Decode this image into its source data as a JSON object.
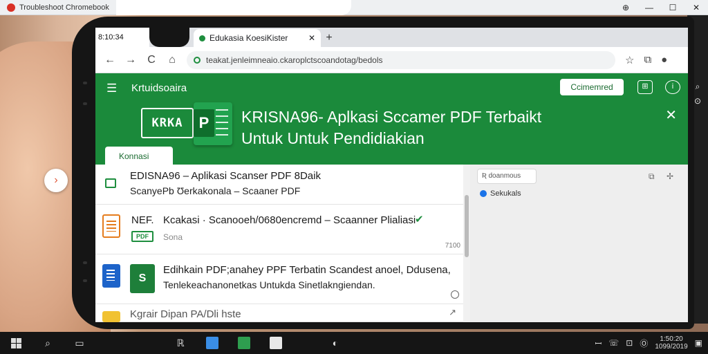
{
  "desktop": {
    "outer_tab_title": "Troubleshoot Chromebook",
    "outer_tab2_label": "",
    "window_controls": [
      "⊕",
      "—",
      "☐",
      "✕"
    ]
  },
  "phone": {
    "status_time": "8:10:34"
  },
  "browser": {
    "tab_title": "Edukasia KoesiKister",
    "tab_close": "✕",
    "new_tab": "+",
    "url": "teakat.jenleimneaio.ckaroplctscoandotag/bedols",
    "nav": {
      "back": "←",
      "forward": "→",
      "reload": "C",
      "home": "⌂"
    },
    "actions": [
      "☆",
      "⧉",
      "●"
    ]
  },
  "app": {
    "name": "Krtuidsoaira",
    "menu_icon": "☰",
    "header_button": "Ccimemred",
    "logo_text": "KRKA",
    "sheet_letter": "P",
    "hero_title_line1": "KRISNA96- Aplkasi Sccamer PDF Terbaikt",
    "hero_title_line2": "Untuk Untuk Pendidiakian",
    "close": "✕",
    "category_chip": "Konnasi"
  },
  "list": {
    "items": [
      {
        "title": "EDISNA96 – Aplikasi Scanser PDF 8Daik",
        "subtitle": "ScanyePb Ʊerkakonala – Scaaner PDF"
      },
      {
        "prefix": "NEF.",
        "title": "Kcakasi · Scanooeh/0680encremd – Scaanner Plialiasi",
        "badge": "✔",
        "mini_label": "PDF",
        "meta": "Sona",
        "count": "7100"
      },
      {
        "sheet_letter": "S",
        "title": "Edihkain PDF;anahey PPF Terbatin Scandest anoel, Ddusena,",
        "subtitle": "Tenlekeachanonetkas Untukda Sinetlakngiendan."
      },
      {
        "title": "Kgrair Dipan PA/Dli hste",
        "arrow": "↗"
      }
    ]
  },
  "side_panel": {
    "search_label": "Ʀ doanmous",
    "item_label": "Sekukals",
    "icons": [
      "⧉",
      "✢"
    ]
  },
  "float_button": "›",
  "right_strip": [
    "⌕",
    "⊙"
  ],
  "taskbar": {
    "tray_icons": [
      "ꟷ",
      "☏",
      "⊡",
      "Ⓞ"
    ],
    "clock_time": "1:50:20",
    "clock_date": "1099/2019"
  }
}
